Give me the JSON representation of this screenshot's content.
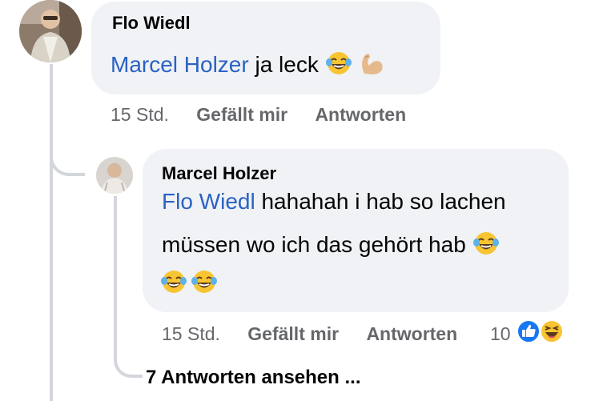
{
  "comments": [
    {
      "author": "Flo Wiedl",
      "mention": "Marcel Holzer",
      "text": "ja leck",
      "emojis": [
        "face-with-tears-of-joy",
        "flexed-biceps"
      ],
      "time": "15 Std.",
      "like_label": "Gefällt mir",
      "reply_label": "Antworten"
    },
    {
      "author": "Marcel Holzer",
      "mention": "Flo Wiedl",
      "text_line1": "hahahah i hab so lachen",
      "text_line2": "müssen wo ich das gehört hab",
      "emojis": [
        "face-with-tears-of-joy",
        "face-with-tears-of-joy",
        "face-with-tears-of-joy"
      ],
      "time": "15 Std.",
      "like_label": "Gefällt mir",
      "reply_label": "Antworten",
      "reaction_count": "10",
      "reactions": [
        "like",
        "haha"
      ]
    }
  ],
  "view_replies": "7 Antworten ansehen ...",
  "colors": {
    "bubble": "#f0f2f5",
    "mention": "#2a62c4",
    "meta": "#65676b",
    "like_blue": "#1877f2",
    "emoji_yellow": "#f7c531"
  }
}
